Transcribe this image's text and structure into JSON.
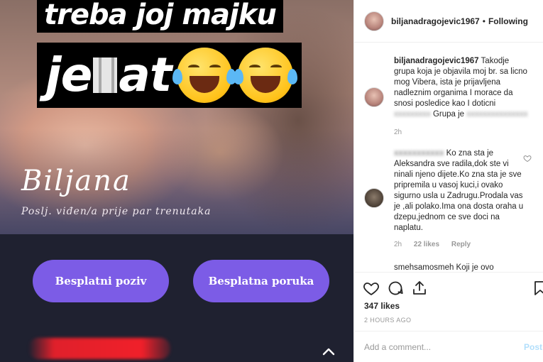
{
  "story": {
    "caption_line1": "treba joj majku",
    "caption_line2_start": "je",
    "caption_line2_end": "at",
    "contact_name": "Biljana",
    "contact_status": "Poslj. viđen/a prije par trenutaka",
    "call_button": "Besplatni poziv",
    "message_button": "Besplatna poruka",
    "emoji_icon": "face-with-tears-of-joy-icon"
  },
  "header": {
    "username": "biljanadragojevic1967",
    "dot": "•",
    "follow_status": "Following"
  },
  "comments": [
    {
      "username": "biljanadragojevic1967",
      "text": "Takodje grupa koja je objavila moj br. sa licno mog Vibera, ista je prijavljena nadleznim organima I morace da snosi posledice kao I doticni",
      "blurred_1": "xxxxxxxxx",
      "text_2": "Grupa je",
      "blurred_2": "xxxxxxxxxxxxxxx",
      "time": "2h"
    },
    {
      "username_blurred": "xxxxxxxxxxx",
      "text": "Ko zna sta je Aleksandra sve radila,dok ste vi ninali njeno dijete.Ko zna sta je sve pripremila u vasoj kuci,i ovako sigurno usla u Zadrugu.Prodala vas je ,ali polako.Ima ona dosta oraha u dzepu,jednom ce sve doci na naplatu.",
      "time": "2h",
      "likes": "22 likes",
      "reply": "Reply"
    }
  ],
  "cutoff_comment": "smehsamosmeh  Koji je ovo",
  "actions": {
    "likes": "347 likes",
    "time_ago": "2 HOURS AGO"
  },
  "add_comment": {
    "placeholder": "Add a comment...",
    "post": "Post"
  },
  "colors": {
    "pill": "#7c5ce6",
    "caption_bg": "#000000",
    "post_link": "#b2dffc"
  }
}
